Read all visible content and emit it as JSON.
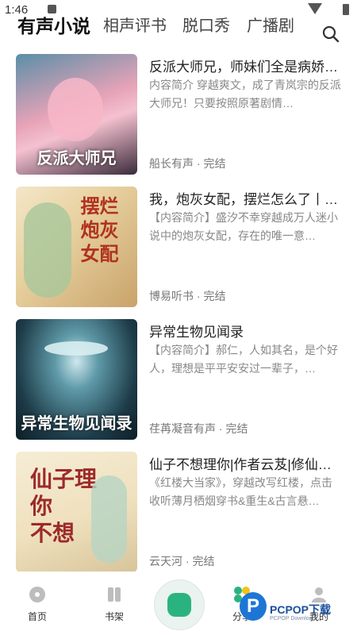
{
  "status_bar": {
    "time": "1:46"
  },
  "tabs": [
    "有声小说",
    "相声评书",
    "脱口秀",
    "广播剧"
  ],
  "items": [
    {
      "title": "反派大师兄，师妹们全是病娇…",
      "desc": "内容简介 穿越爽文，成了青岚宗的反派大师兄！只要按照原著剧情…",
      "meta": "船长有声 · 完结",
      "cover_caption": "反派大师兄"
    },
    {
      "title": "我，炮灰女配，摆烂怎么了丨…",
      "desc": "【内容简介】盛汐不幸穿越成万人迷小说中的炮灰女配，存在的唯一意…",
      "meta": "博易听书 · 完结",
      "cover_caption": "摆烂 炮灰女配"
    },
    {
      "title": "异常生物见闻录",
      "desc": "【内容简介】郝仁，人如其名，是个好人，理想是平平安安过一辈子，…",
      "meta": "荏苒凝音有声 · 完结",
      "cover_caption": "异常生物见闻录"
    },
    {
      "title": "仙子不想理你|作者云芨|修仙…",
      "desc": "《红楼大当家》，穿越改写红楼，点击收听薄月栖烟穿书&重生&古言悬…",
      "meta": "云天河 · 完结",
      "cover_caption": "仙子不想理你"
    }
  ],
  "bottom_nav": {
    "home": "首页",
    "shelf": "书架",
    "share": "分享",
    "mine": "我的"
  },
  "watermark": {
    "brand": "PCPOP下载",
    "sub": "PCPOP Download"
  },
  "colors": {
    "accent": "#2bb37f"
  }
}
